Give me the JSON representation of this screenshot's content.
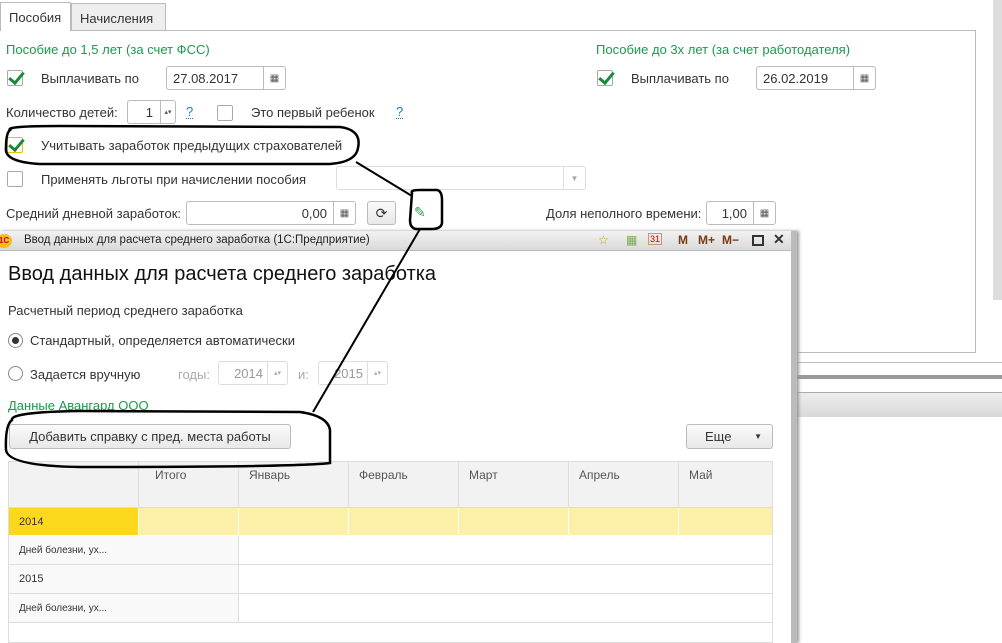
{
  "tabs": [
    {
      "label": "Пособия",
      "active": true
    },
    {
      "label": "Начисления",
      "active": false
    }
  ],
  "fss": {
    "title": "Пособие до 1,5 лет (за счет ФСС)",
    "pay_label": "Выплачивать по",
    "pay_checked": true,
    "pay_date": "27.08.2017"
  },
  "employer": {
    "title": "Пособие до 3х лет (за счет работодателя)",
    "pay_label": "Выплачивать по",
    "pay_checked": true,
    "pay_date": "26.02.2019"
  },
  "children": {
    "label": "Количество детей:",
    "value": "1",
    "help": "?",
    "first_child_label": "Это первый ребенок",
    "first_child_checked": false,
    "first_help": "?"
  },
  "prev_employers": {
    "label": "Учитывать заработок предыдущих страхователей",
    "checked": true
  },
  "benefits": {
    "label": "Применять льготы при начислении пособия",
    "checked": false,
    "value": ""
  },
  "avg_daily": {
    "label": "Средний дневной заработок:",
    "value": "0,00"
  },
  "part_time": {
    "label": "Доля неполного времени:",
    "value": "1,00"
  },
  "dialog": {
    "window_title": "Ввод данных для расчета среднего заработка  (1С:Предприятие)",
    "app_icon": "1C",
    "toolbar": [
      "M",
      "M+",
      "M−"
    ],
    "heading": "Ввод данных для расчета среднего заработка",
    "period_label": "Расчетный период среднего заработка",
    "radio_standard": "Стандартный, определяется автоматически",
    "radio_manual": "Задается вручную",
    "years_label": "годы:",
    "year_from": "2014",
    "and_label": "и:",
    "year_to": "2015",
    "company_link": "Данные Авангард ООО",
    "add_button": "Добавить справку с пред. места работы",
    "more_button": "Еще",
    "columns": [
      "",
      "Итого",
      "Январь",
      "Февраль",
      "Март",
      "Апрель",
      "Май"
    ],
    "rows": [
      "2014",
      "Дней болезни, ух...",
      "2015",
      "Дней болезни, ух..."
    ]
  }
}
